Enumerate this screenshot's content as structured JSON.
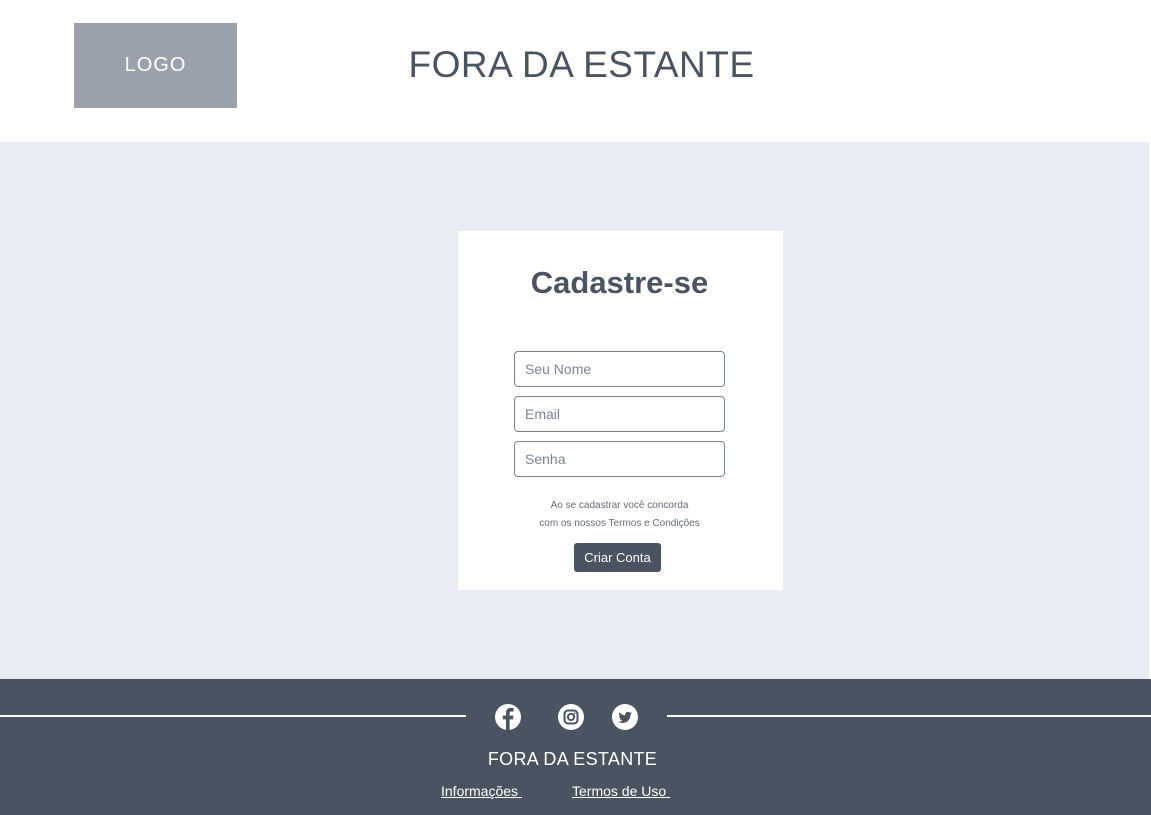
{
  "header": {
    "logo_label": "LOGO",
    "site_title": "FORA DA ESTANTE"
  },
  "signup": {
    "title": "Cadastre-se",
    "name_placeholder": "Seu Nome",
    "email_placeholder": "Email",
    "password_placeholder": "Senha",
    "terms_line1": "Ao se cadastrar você concorda",
    "terms_line2": "com os nossos Termos e Condições",
    "submit_label": "Criar Conta"
  },
  "footer": {
    "social_icons": [
      "facebook-icon",
      "instagram-icon",
      "twitter-icon"
    ],
    "title": "FORA DA ESTANTE",
    "links": [
      "Informações ",
      "Termos de Uso "
    ]
  },
  "colors": {
    "background": "#e8ebf2",
    "primary": "#4a5360",
    "logo_placeholder": "#9ba1ab"
  }
}
